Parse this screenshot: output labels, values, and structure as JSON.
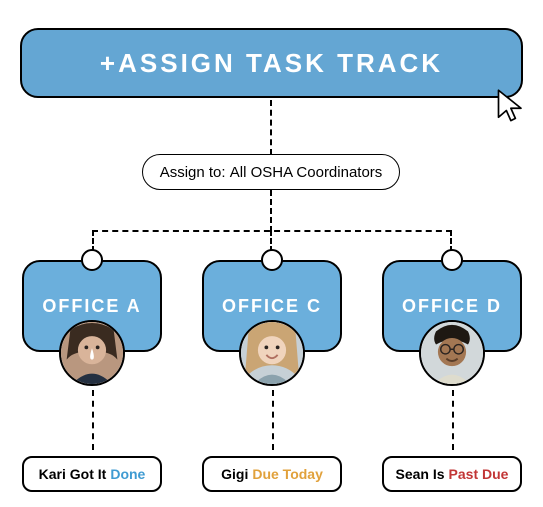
{
  "assign_button_label": "+ASSIGN TASK TRACK",
  "assign_to": {
    "label": "Assign to:",
    "target": "All OSHA Coordinators"
  },
  "offices": {
    "a": {
      "name": "OFFICE A",
      "person": "Kari",
      "status_text": "Kari Got It",
      "status_suffix": "Done",
      "status_type": "done"
    },
    "c": {
      "name": "OFFICE C",
      "person": "Gigi",
      "status_text": "Gigi",
      "status_suffix": "Due Today",
      "status_type": "duetoday"
    },
    "d": {
      "name": "OFFICE D",
      "person": "Sean",
      "status_text": "Sean Is",
      "status_suffix": "Past Due",
      "status_type": "pastdue"
    }
  },
  "colors": {
    "brand_blue": "#64a6d3",
    "done": "#3f9bd2",
    "due_today": "#e1a13b",
    "past_due": "#c23636"
  }
}
